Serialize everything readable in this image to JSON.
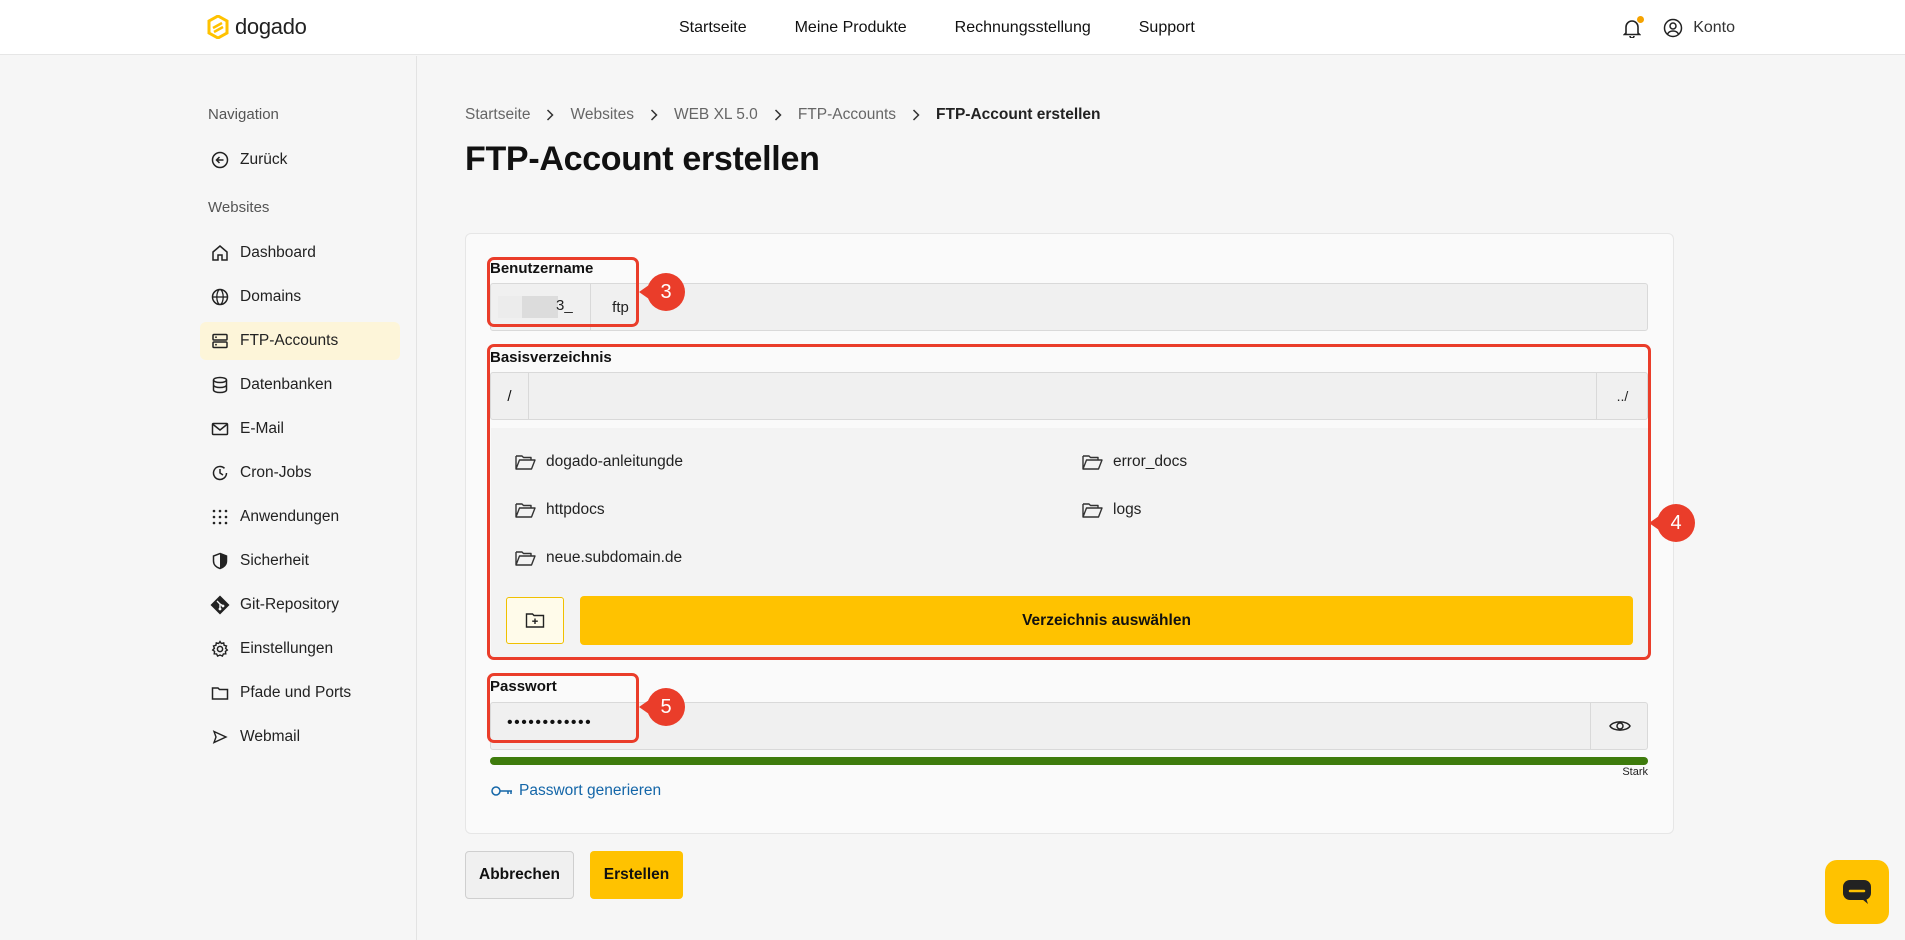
{
  "brand": {
    "name": "dogado"
  },
  "topnav": [
    "Startseite",
    "Meine Produkte",
    "Rechnungsstellung",
    "Support"
  ],
  "account": {
    "label": "Konto"
  },
  "sidebar": {
    "heading_nav": "Navigation",
    "back": "Zurück",
    "heading_websites": "Websites",
    "items": [
      "Dashboard",
      "Domains",
      "FTP-Accounts",
      "Datenbanken",
      "E-Mail",
      "Cron-Jobs",
      "Anwendungen",
      "Sicherheit",
      "Git-Repository",
      "Einstellungen",
      "Pfade und Ports",
      "Webmail"
    ],
    "active": "FTP-Accounts"
  },
  "breadcrumb": [
    "Startseite",
    "Websites",
    "WEB XL 5.0",
    "FTP-Accounts",
    "FTP-Account erstellen"
  ],
  "page_title": "FTP-Account erstellen",
  "form": {
    "username": {
      "label": "Benutzername",
      "value_tail": "3_",
      "suffix": "ftp"
    },
    "basedir": {
      "label": "Basisverzeichnis",
      "prefix": "/",
      "value": "",
      "up": "../",
      "folders": [
        "dogado-anleitungde",
        "error_docs",
        "httpdocs",
        "logs",
        "neue.subdomain.de"
      ],
      "select_label": "Verzeichnis auswählen"
    },
    "password": {
      "label": "Passwort",
      "value": "••••••••••••",
      "strength_label": "Stark",
      "strength": 1.0,
      "generate_label": "Passwort generieren"
    }
  },
  "actions": {
    "cancel": "Abbrechen",
    "create": "Erstellen"
  },
  "annotations": [
    "3",
    "4",
    "5"
  ],
  "colors": {
    "accent": "#ffc200",
    "annotation": "#ea3d2a",
    "strength": "#3e7b0c",
    "link": "#1466a8"
  }
}
